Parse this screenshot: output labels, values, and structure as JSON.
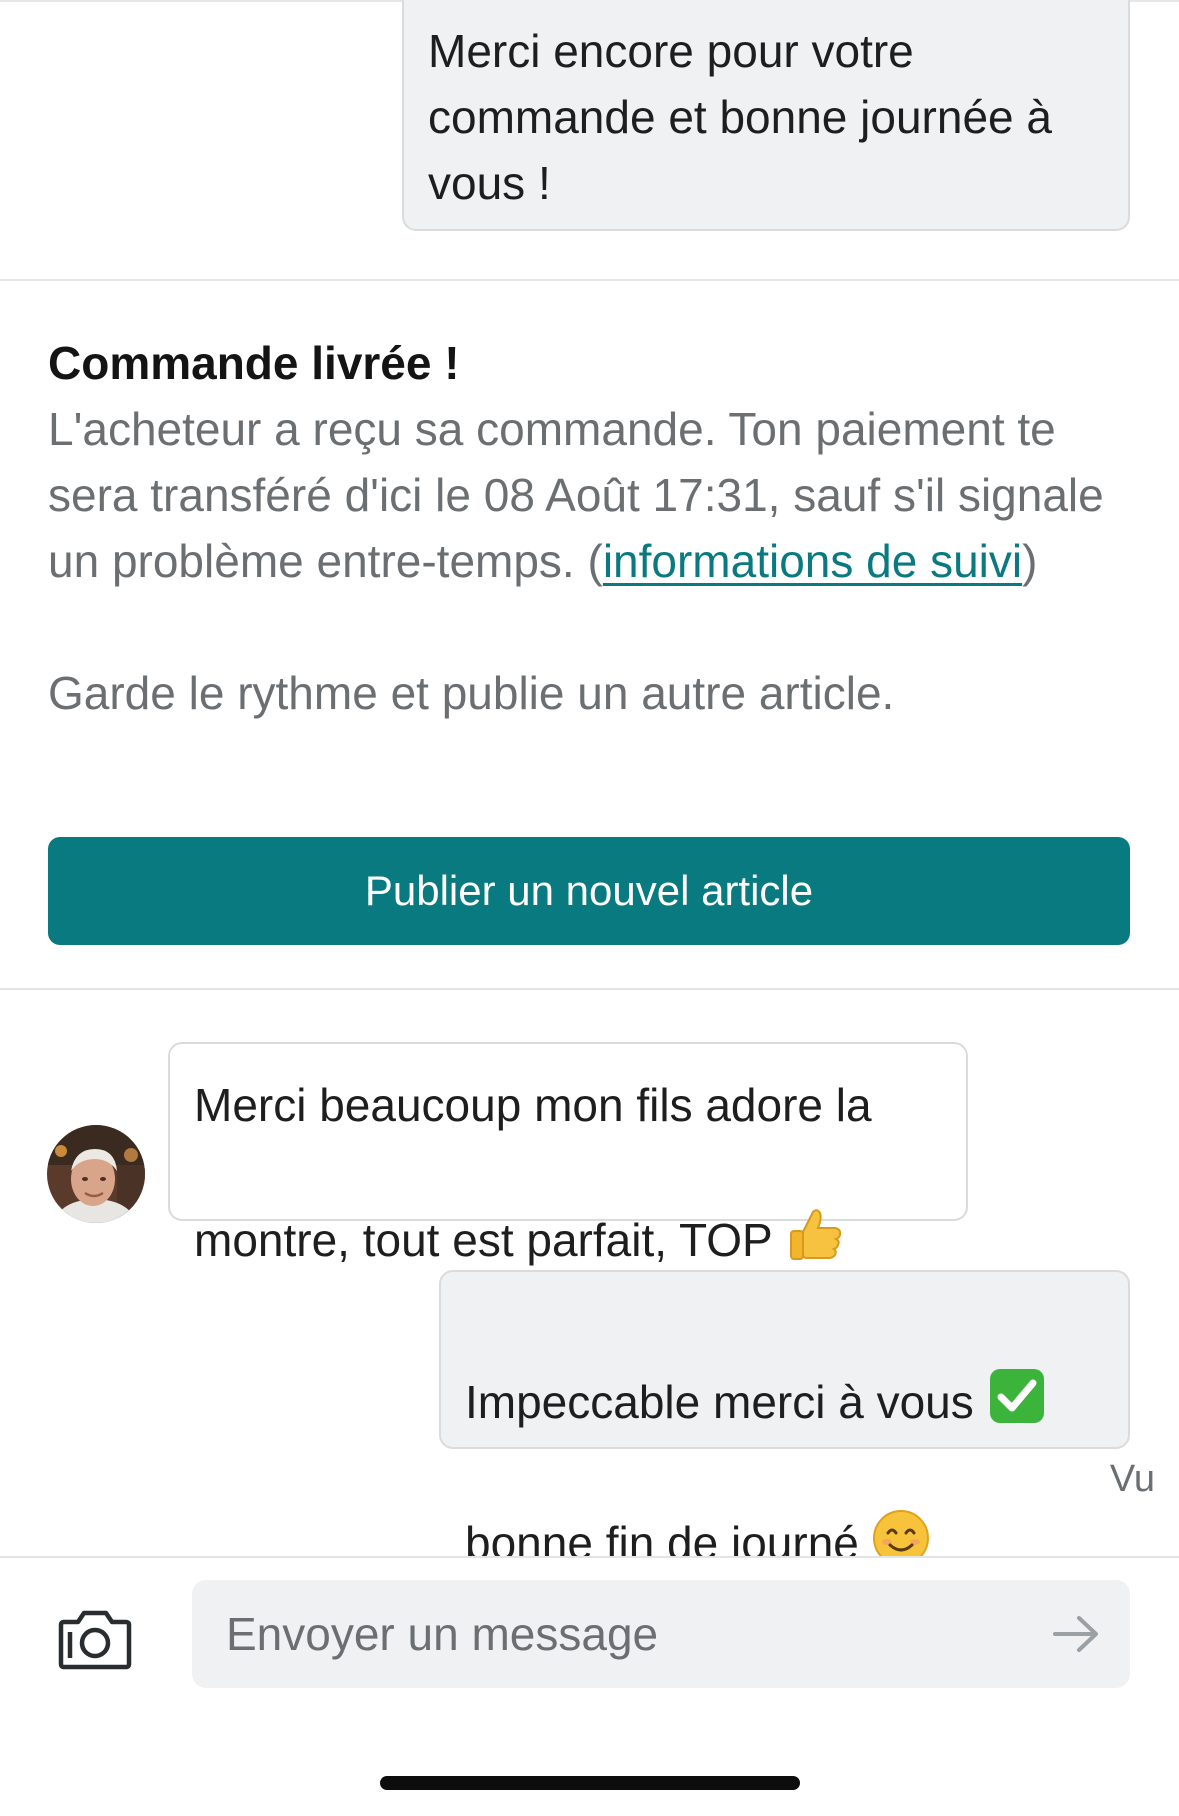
{
  "messages": {
    "top_outgoing": "Merci encore pour votre\ncommande et bonne journée à\nvous !",
    "incoming": "Merci beaucoup mon fils adore la\nmontre, tout est parfait, TOP ",
    "outgoing_line1": "Impeccable merci à vous ",
    "outgoing_line2": "bonne fin de journé "
  },
  "icons": {
    "incoming_emoji": "thumbs-up-icon",
    "outgoing_emoji_1": "check-mark-button-icon",
    "outgoing_emoji_2": "smiling-face-icon",
    "camera": "camera-icon",
    "send": "arrow-right-icon"
  },
  "system": {
    "title": "Commande livrée !",
    "body_before_link": "L'acheteur a reçu sa commande. Ton paiement te sera transféré d'ici le 08 Août 17:31, sauf s'il signale un problème entre-temps. (",
    "link_text": "informations de suivi",
    "body_after_link": ")",
    "cta_text": "Garde le rythme et publie un autre article.",
    "button_label": "Publier un nouvel article"
  },
  "status": {
    "seen": "Vu"
  },
  "composer": {
    "placeholder": "Envoyer un message"
  },
  "colors": {
    "accent": "#087a80",
    "link": "#0a7a80",
    "bubble_outgoing": "#eff1f2",
    "muted_text": "#6b6f72"
  }
}
